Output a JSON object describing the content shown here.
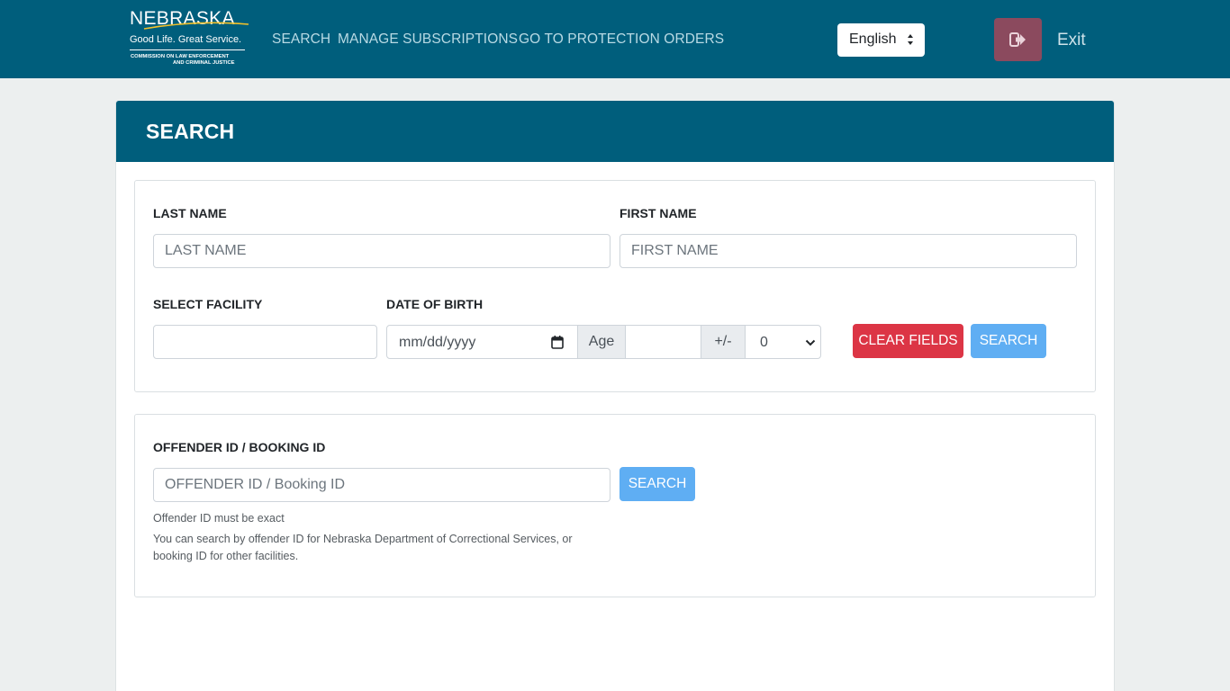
{
  "header": {
    "logo": {
      "wordmark": "NEBRASKA",
      "tagline": "Good Life. Great Service.",
      "org_line1": "COMMISSION ON LAW ENFORCEMENT",
      "org_line2": "AND CRIMINAL JUSTICE"
    },
    "nav": [
      {
        "label": "SEARCH"
      },
      {
        "label": "MANAGE SUBSCRIPTIONS"
      },
      {
        "label": "GO TO PROTECTION ORDERS"
      }
    ],
    "language": {
      "selected": "English"
    },
    "exit_label": "Exit"
  },
  "card": {
    "title": "SEARCH"
  },
  "name_search": {
    "last_name": {
      "label": "LAST NAME",
      "placeholder": "LAST NAME",
      "value": ""
    },
    "first_name": {
      "label": "FIRST NAME",
      "placeholder": "FIRST NAME",
      "value": ""
    },
    "facility": {
      "label": "SELECT FACILITY",
      "value": ""
    },
    "dob": {
      "label": "DATE OF BIRTH",
      "placeholder": "mm/dd/yyyy"
    },
    "age": {
      "label": "Age",
      "value": ""
    },
    "tolerance": {
      "label": "+/-",
      "selected": "0"
    },
    "clear_button": "CLEAR FIELDS",
    "search_button": "SEARCH"
  },
  "id_search": {
    "label": "OFFENDER ID / BOOKING ID",
    "placeholder": "OFFENDER ID / Booking ID",
    "value": "",
    "search_button": "SEARCH",
    "help_exact": "Offender ID must be exact",
    "help_detail": "You can search by offender ID for Nebraska Department of Correctional Services, or booking ID for other facilities."
  },
  "colors": {
    "brand": "#005e7c",
    "danger": "#dc3545",
    "primary": "#5faef3",
    "exit": "#8b4a5e"
  }
}
